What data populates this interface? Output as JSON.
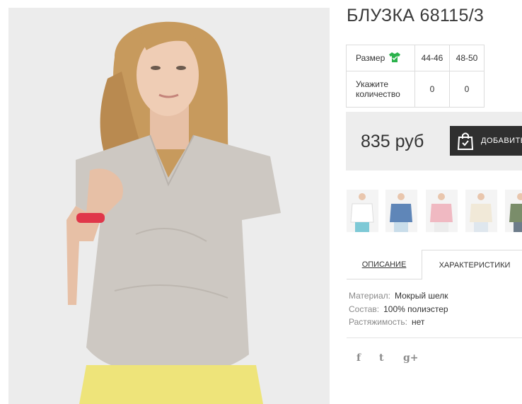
{
  "product": {
    "title": "БЛУЗКА 68115/3",
    "price": "835 руб",
    "add_to_cart_label": "ДОБАВИТЬ"
  },
  "size_table": {
    "size_label": "Размер",
    "sizes": [
      "44-46",
      "48-50"
    ],
    "quantity_label_line1": "Укажите",
    "quantity_label_line2": "количество",
    "quantities": [
      "0",
      "0"
    ]
  },
  "thumbnails": [
    {
      "color": "white"
    },
    {
      "color": "denim-blue"
    },
    {
      "color": "pink"
    },
    {
      "color": "cream"
    },
    {
      "color": "olive-green"
    }
  ],
  "tabs": {
    "description": "ОПИСАНИЕ",
    "characteristics": "ХАРАКТЕРИСТИКИ"
  },
  "specs": [
    {
      "label": "Материал:",
      "value": "Мокрый шелк"
    },
    {
      "label": "Состав:",
      "value": "100% полиэстер"
    },
    {
      "label": "Растяжимость:",
      "value": "нет"
    }
  ],
  "social": {
    "facebook": "f",
    "twitter": "t",
    "googleplus": "g+"
  },
  "colors": {
    "accent_green": "#2bb24c",
    "button_dark": "#2f2f2f",
    "price_bg": "#ededed"
  },
  "icons": [
    "tshirt-check-icon",
    "shopping-bag-icon",
    "facebook-icon",
    "twitter-icon",
    "google-plus-icon"
  ]
}
